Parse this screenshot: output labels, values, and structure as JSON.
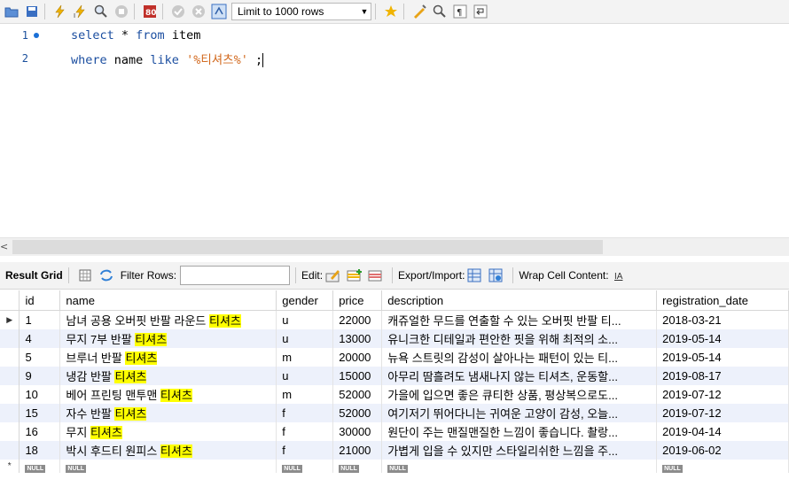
{
  "toolbar": {
    "limit_label": "Limit to 1000 rows",
    "icons": [
      "open-folder-icon",
      "save-icon",
      "execute-icon",
      "execute-current-icon",
      "explain-icon",
      "stop-icon",
      "toggle-error-icon",
      "commit-icon",
      "rollback-icon",
      "autocommit-icon",
      "limit-dropdown",
      "favorite-icon",
      "beautify-icon",
      "find-icon",
      "invisible-chars-icon",
      "wrap-icon"
    ]
  },
  "editor": {
    "lines": [
      {
        "number": "1",
        "kw1": "select",
        "p1": " * ",
        "kw2": "from",
        "p2": " item"
      },
      {
        "number": "2",
        "kw1": "where",
        "p1": " name ",
        "kw2": "like",
        "str": " '%티셔츠%'",
        "p2": " ;"
      }
    ]
  },
  "result_toolbar": {
    "result_grid": "Result Grid",
    "filter_rows": "Filter Rows:",
    "edit": "Edit:",
    "export_import": "Export/Import:",
    "wrap_cell": "Wrap Cell Content:"
  },
  "grid": {
    "columns": [
      "id",
      "name",
      "gender",
      "price",
      "description",
      "registration_date"
    ],
    "rows": [
      {
        "id": "1",
        "name_pre": "남녀 공용 오버핏 반팔 라운드 ",
        "name_hl": "티셔츠",
        "gender": "u",
        "price": "22000",
        "description": "캐쥬얼한 무드를 연출할 수 있는 오버핏 반팔 티...",
        "date": "2018-03-21"
      },
      {
        "id": "4",
        "name_pre": "무지 7부 반팔 ",
        "name_hl": "티셔츠",
        "gender": "u",
        "price": "13000",
        "description": "유니크한 디테일과 편안한 핏을 위해 최적의 소...",
        "date": "2019-05-14"
      },
      {
        "id": "5",
        "name_pre": "브루너 반팔 ",
        "name_hl": "티셔츠",
        "gender": "m",
        "price": "20000",
        "description": "뉴욕 스트릿의 감성이 살아나는 패턴이 있는 티...",
        "date": "2019-05-14"
      },
      {
        "id": "9",
        "name_pre": "냉감 반팔 ",
        "name_hl": "티셔츠",
        "gender": "u",
        "price": "15000",
        "description": "아무리 땀흘려도 냄새나지 않는 티셔츠, 운동할...",
        "date": "2019-08-17"
      },
      {
        "id": "10",
        "name_pre": "베어 프린팅 맨투맨 ",
        "name_hl": "티셔츠",
        "gender": "m",
        "price": "52000",
        "description": "가을에 입으면 좋은 큐티한 상품, 평상복으로도...",
        "date": "2019-07-12"
      },
      {
        "id": "15",
        "name_pre": "자수 반팔 ",
        "name_hl": "티셔츠",
        "gender": "f",
        "price": "52000",
        "description": "여기저기 뛰어다니는 귀여운 고양이 감성, 오늘...",
        "date": "2019-07-12"
      },
      {
        "id": "16",
        "name_pre": "무지 ",
        "name_hl": "티셔츠",
        "gender": "f",
        "price": "30000",
        "description": "원단이 주는 맨질맨질한 느낌이 좋습니다. 촬랑...",
        "date": "2019-04-14"
      },
      {
        "id": "18",
        "name_pre": "박시 후드티 원피스 ",
        "name_hl": "티셔츠",
        "gender": "f",
        "price": "21000",
        "description": "가볍게 입을 수 있지만 스타일리쉬한 느낌을 주...",
        "date": "2019-06-02"
      }
    ],
    "null_label": "NULL"
  },
  "colors": {
    "keyword": "#1b4ea0",
    "string": "#d2691e",
    "highlight": "#ffff00",
    "alt_row": "#edf1fb"
  }
}
